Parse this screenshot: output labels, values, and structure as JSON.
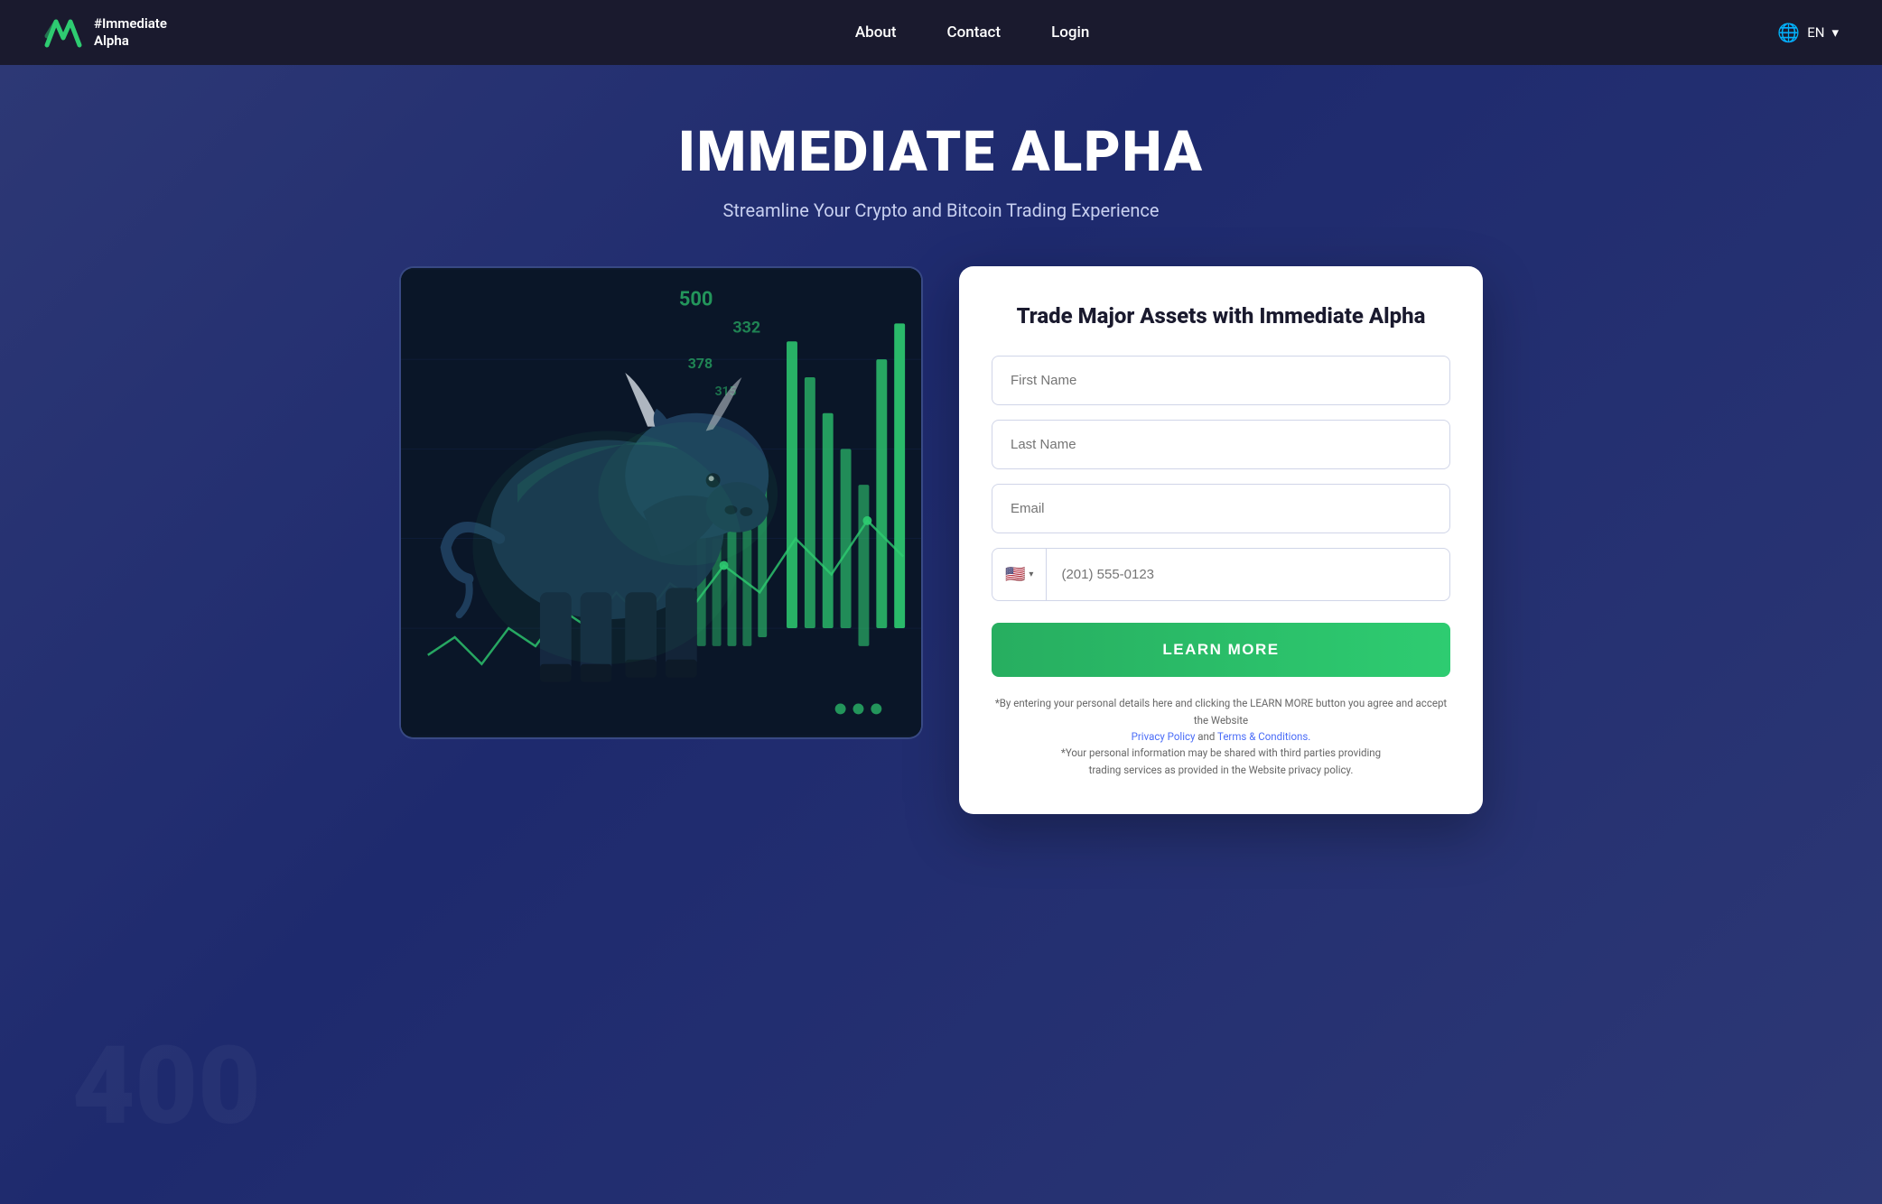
{
  "nav": {
    "logo_hashtag": "#Immediate",
    "logo_name": "Alpha",
    "links": [
      {
        "label": "About",
        "id": "about"
      },
      {
        "label": "Contact",
        "id": "contact"
      },
      {
        "label": "Login",
        "id": "login"
      }
    ],
    "language": "EN",
    "language_arrow": "▾"
  },
  "hero": {
    "title": "IMMEDIATE ALPHA",
    "subtitle": "Streamline Your Crypto and Bitcoin Trading Experience"
  },
  "form": {
    "title": "Trade Major Assets with Immediate Alpha",
    "first_name_placeholder": "First Name",
    "last_name_placeholder": "Last Name",
    "email_placeholder": "Email",
    "phone_placeholder": "(201) 555-0123",
    "phone_flag": "🇺🇸",
    "phone_flag_code": "•",
    "cta_label": "LEARN MORE",
    "disclaimer_1": "*By entering your personal details here and clicking the",
    "disclaimer_2": "LEARN MORE button you agree and accept the Website",
    "disclaimer_3": "Privacy Policy",
    "disclaimer_4": " and ",
    "disclaimer_5": "Terms & Conditions.",
    "disclaimer_6": "*Your personal information may be shared with third parties providing",
    "disclaimer_7": "trading services as provided in the Website privacy policy."
  }
}
